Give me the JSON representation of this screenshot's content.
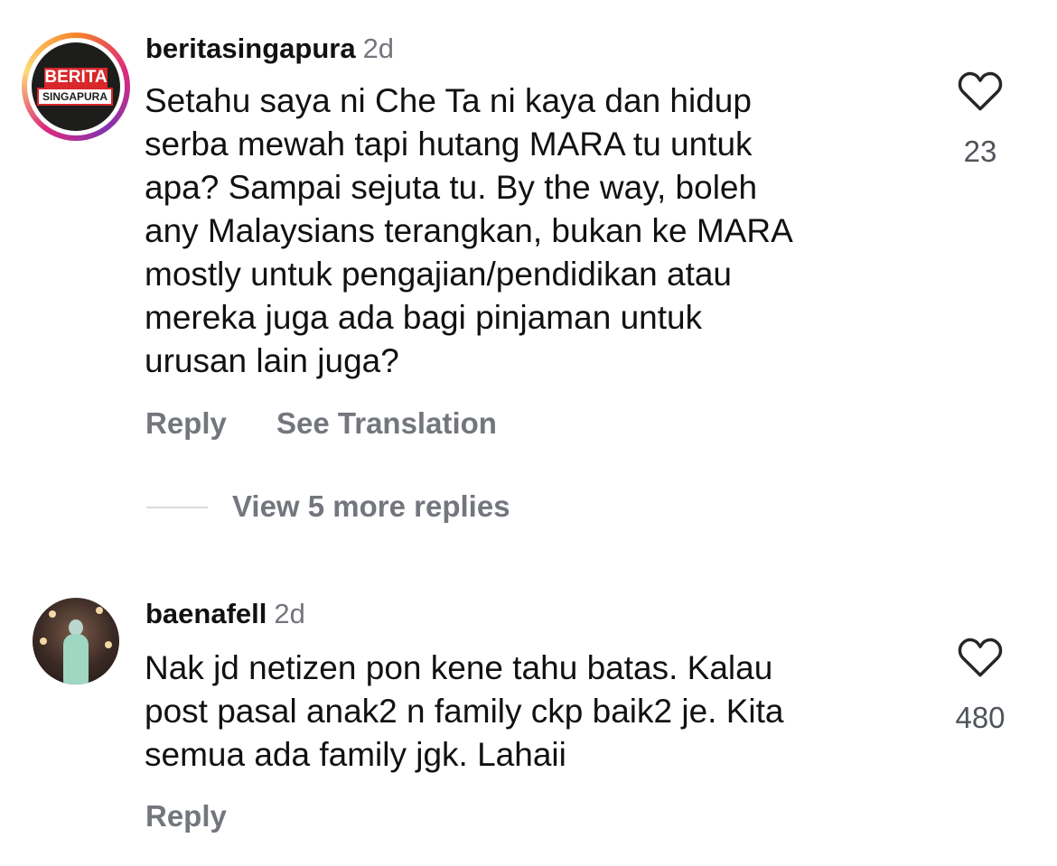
{
  "comments": [
    {
      "username": "beritasingapura",
      "time": "2d",
      "avatar_logo": {
        "top": "BERITA",
        "bottom": "SINGAPURA"
      },
      "text": "Setahu saya ni Che Ta ni kaya dan hidup\nserba mewah tapi hutang MARA tu untuk\napa? Sampai sejuta tu. By the way, boleh\nany Malaysians terangkan, bukan ke MARA\nmostly untuk pengajian/pendidikan atau\nmereka juga ada bagi pinjaman untuk\nurusan lain juga?",
      "likes": "23",
      "reply_label": "Reply",
      "translate_label": "See Translation",
      "view_replies_label": "View 5 more replies"
    },
    {
      "username": "baenafell",
      "time": "2d",
      "text": "Nak jd netizen pon kene tahu batas. Kalau\npost pasal anak2 n family ckp baik2 je. Kita\nsemua ada family jgk. Lahaii",
      "likes": "480",
      "reply_label": "Reply"
    }
  ],
  "icons": {
    "like": "heart-outline-icon"
  },
  "colors": {
    "secondary_text": "#73767d",
    "primary_text": "#111111"
  }
}
